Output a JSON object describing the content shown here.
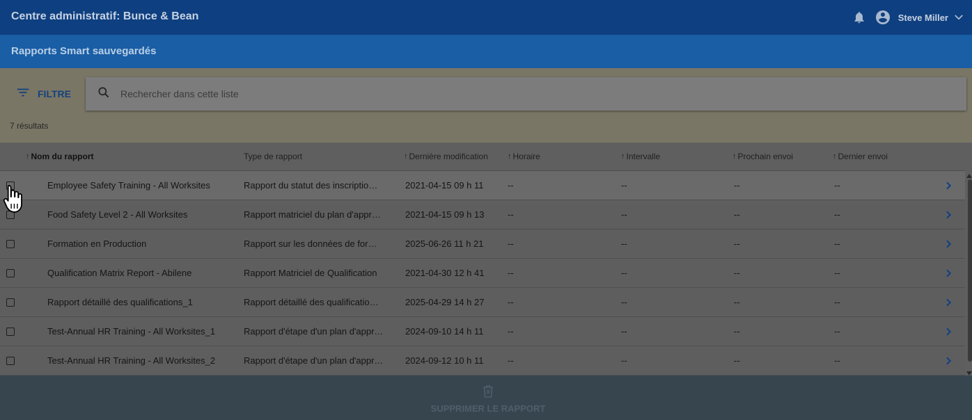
{
  "app": {
    "title": "Centre administratif: Bunce & Bean"
  },
  "header": {
    "user_name": "Steve Miller",
    "notification_icon": "bell-icon",
    "account_icon": "account-circle-icon"
  },
  "page": {
    "title": "Rapports Smart sauvegardés"
  },
  "filter": {
    "label": "FILTRE"
  },
  "search": {
    "placeholder": "Rechercher dans cette liste"
  },
  "results": {
    "count_text": "7 résultats"
  },
  "table": {
    "headers": {
      "name": "Nom du rapport",
      "type": "Type de rapport",
      "modified": "Dernière modification",
      "schedule": "Horaire",
      "interval": "Intervalle",
      "next": "Prochain envoi",
      "last": "Dernier envoi"
    },
    "rows": [
      {
        "name": "Employee Safety Training - All Worksites",
        "type": "Rapport du statut des inscriptio…",
        "modified": "2021-04-15 09 h 11",
        "schedule": "--",
        "interval": "--",
        "next": "--",
        "last": "--"
      },
      {
        "name": "Food Safety Level 2 - All Worksites",
        "type": "Rapport matriciel du plan d'appr…",
        "modified": "2021-04-15 09 h 13",
        "schedule": "--",
        "interval": "--",
        "next": "--",
        "last": "--"
      },
      {
        "name": "Formation en Production",
        "type": "Rapport sur les données de for…",
        "modified": "2025-06-26 11 h 21",
        "schedule": "--",
        "interval": "--",
        "next": "--",
        "last": "--"
      },
      {
        "name": "Qualification Matrix Report - Abilene",
        "type": "Rapport Matriciel de Qualification",
        "modified": "2021-04-30 12 h 41",
        "schedule": "--",
        "interval": "--",
        "next": "--",
        "last": "--"
      },
      {
        "name": "Rapport détaillé des qualifications_1",
        "type": "Rapport détaillé des qualificatio…",
        "modified": "2025-04-29 14 h 27",
        "schedule": "--",
        "interval": "--",
        "next": "--",
        "last": "--"
      },
      {
        "name": "Test-Annual HR Training - All Worksites_1",
        "type": "Rapport d'étape d'un plan d'appr…",
        "modified": "2024-09-10 14 h 11",
        "schedule": "--",
        "interval": "--",
        "next": "--",
        "last": "--"
      },
      {
        "name": "Test-Annual HR Training - All Worksites_2",
        "type": "Rapport d'étape d'un plan d'appr…",
        "modified": "2024-09-12 10 h 11",
        "schedule": "--",
        "interval": "--",
        "next": "--",
        "last": "--"
      }
    ]
  },
  "actions": {
    "delete_label": "SUPPRIMER LE RAPPORT"
  },
  "colors": {
    "topbar": "#0e3f80",
    "subbar": "#1a5ea5",
    "accent": "#15427c",
    "bottombar": "#37454f"
  }
}
